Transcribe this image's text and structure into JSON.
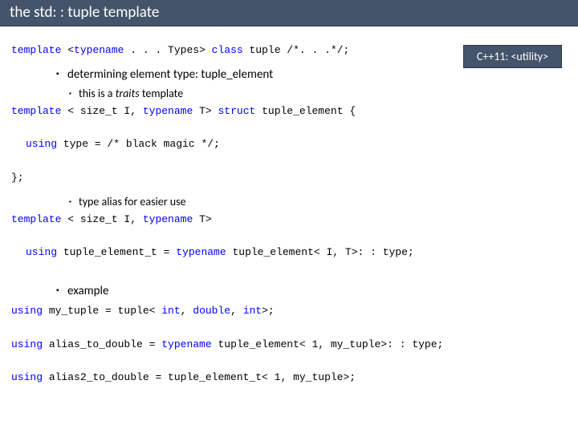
{
  "title": "the std: : tuple template",
  "badge": "C++11: <utility>",
  "code1": {
    "kw1": "template",
    "t1": " <",
    "kw2": "typename",
    "t2": " . . . Types> ",
    "kw3": "class",
    "t3": " tuple /*. . .*/;"
  },
  "bullet1": "determining element type: tuple_element",
  "bullet1a_pre": "this is a ",
  "bullet1a_em": "traits",
  "bullet1a_post": " template",
  "code2": {
    "kw1": "template",
    "t1": " < size_t I, ",
    "kw2": "typename",
    "t2": " T> ",
    "kw3": "struct",
    "t3": " tuple_element {",
    "kw4": "using",
    "t4": " type = /* black magic */;",
    "t5": "};"
  },
  "bullet1b": "type alias for easier use",
  "code3": {
    "kw1": "template",
    "t1": " < size_t I, ",
    "kw2": "typename",
    "t2": " T>",
    "kw3": "using",
    "t3": " tuple_element_t = ",
    "kw4": "typename",
    "t4": " tuple_element< I, T>: : type;"
  },
  "bullet2": "example",
  "code4": {
    "kw1": "using",
    "t1": " my_tuple = tuple< ",
    "kw2": "int",
    "t2": ", ",
    "kw3": "double",
    "t3": ", ",
    "kw4": "int",
    "t4": ">;",
    "kw5": "using",
    "t5": " alias_to_double = ",
    "kw6": "typename",
    "t6": " tuple_element< 1, my_tuple>: : type;",
    "kw7": "using",
    "t7": " alias2_to_double = tuple_element_t< 1, my_tuple>;"
  }
}
